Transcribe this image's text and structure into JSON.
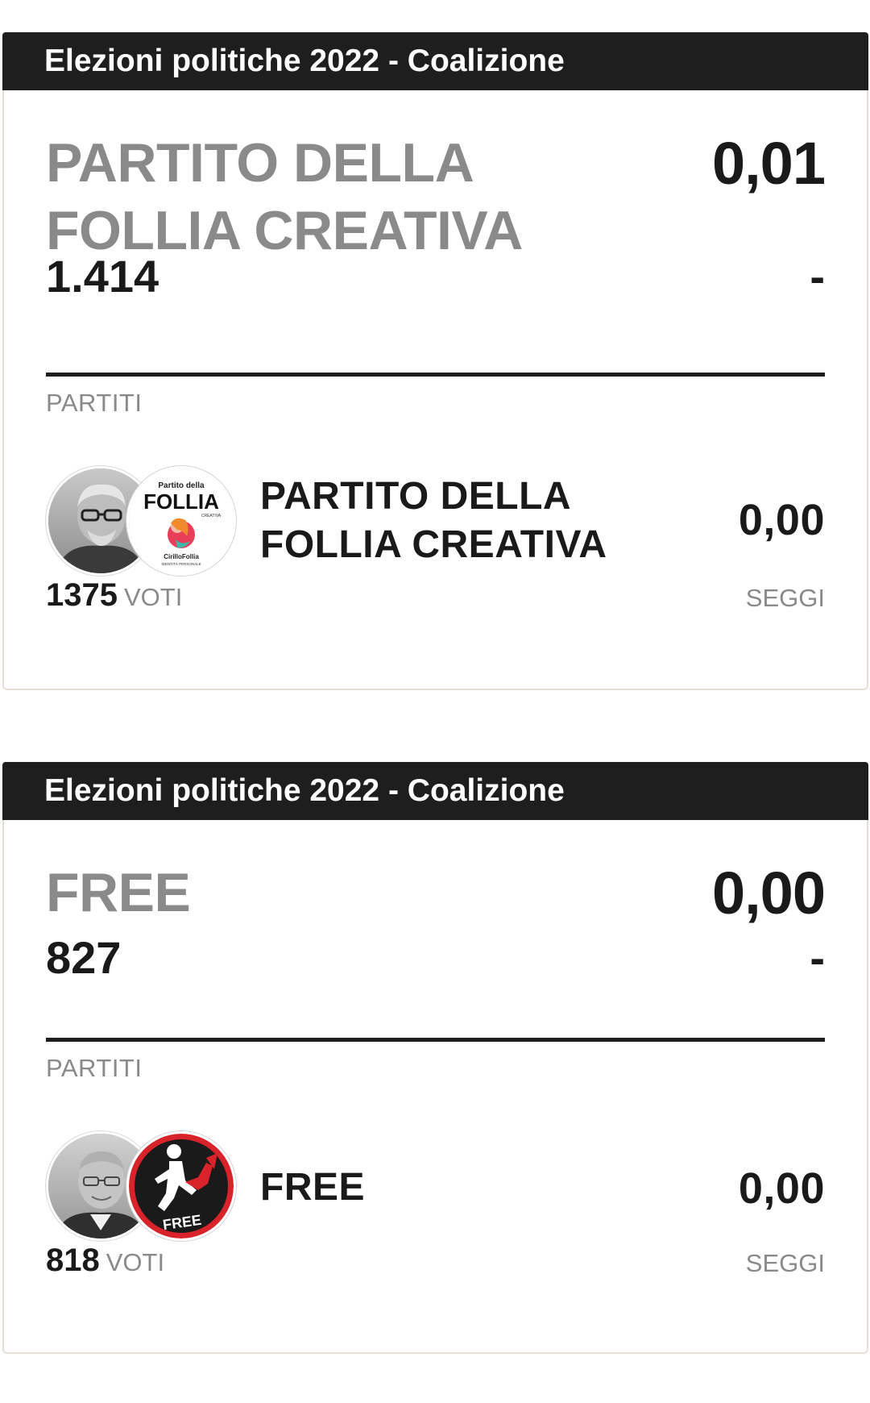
{
  "cards": [
    {
      "header": "Elezioni politiche 2022 - Coalizione",
      "coalition": {
        "name": "PARTITO DELLA FOLLIA CREATIVA",
        "percent": "0,01",
        "votes": "1.414",
        "seats": "-"
      },
      "section_label": "PARTITI",
      "party": {
        "name": "PARTITO DELLA FOLLIA CREATIVA",
        "percent": "0,00",
        "votes": "1375",
        "votes_unit": "VOTI",
        "seats_label": "SEGGI",
        "logo_texts": [
          "Partito della",
          "FOLLIA",
          "CREATIVA",
          "CirilloFollia",
          "IDENTITÀ PERSONALE"
        ]
      }
    },
    {
      "header": "Elezioni politiche 2022 - Coalizione",
      "coalition": {
        "name": "FREE",
        "percent": "0,00",
        "votes": "827",
        "seats": "-"
      },
      "section_label": "PARTITI",
      "party": {
        "name": "FREE",
        "percent": "0,00",
        "votes": "818",
        "votes_unit": "VOTI",
        "seats_label": "SEGGI",
        "logo_texts": [
          "FREE"
        ]
      }
    }
  ],
  "colors": {
    "header_bg": "#1e1e1e",
    "muted_text": "#8a8a8a",
    "card_border": "#e4e0d8",
    "free_logo_red": "#d8232a"
  },
  "icons": {
    "card1_avatar": "candidate-photo-icon",
    "card1_logo": "follia-creativa-logo-icon",
    "card2_avatar": "candidate-photo-icon",
    "card2_logo": "free-logo-icon"
  }
}
